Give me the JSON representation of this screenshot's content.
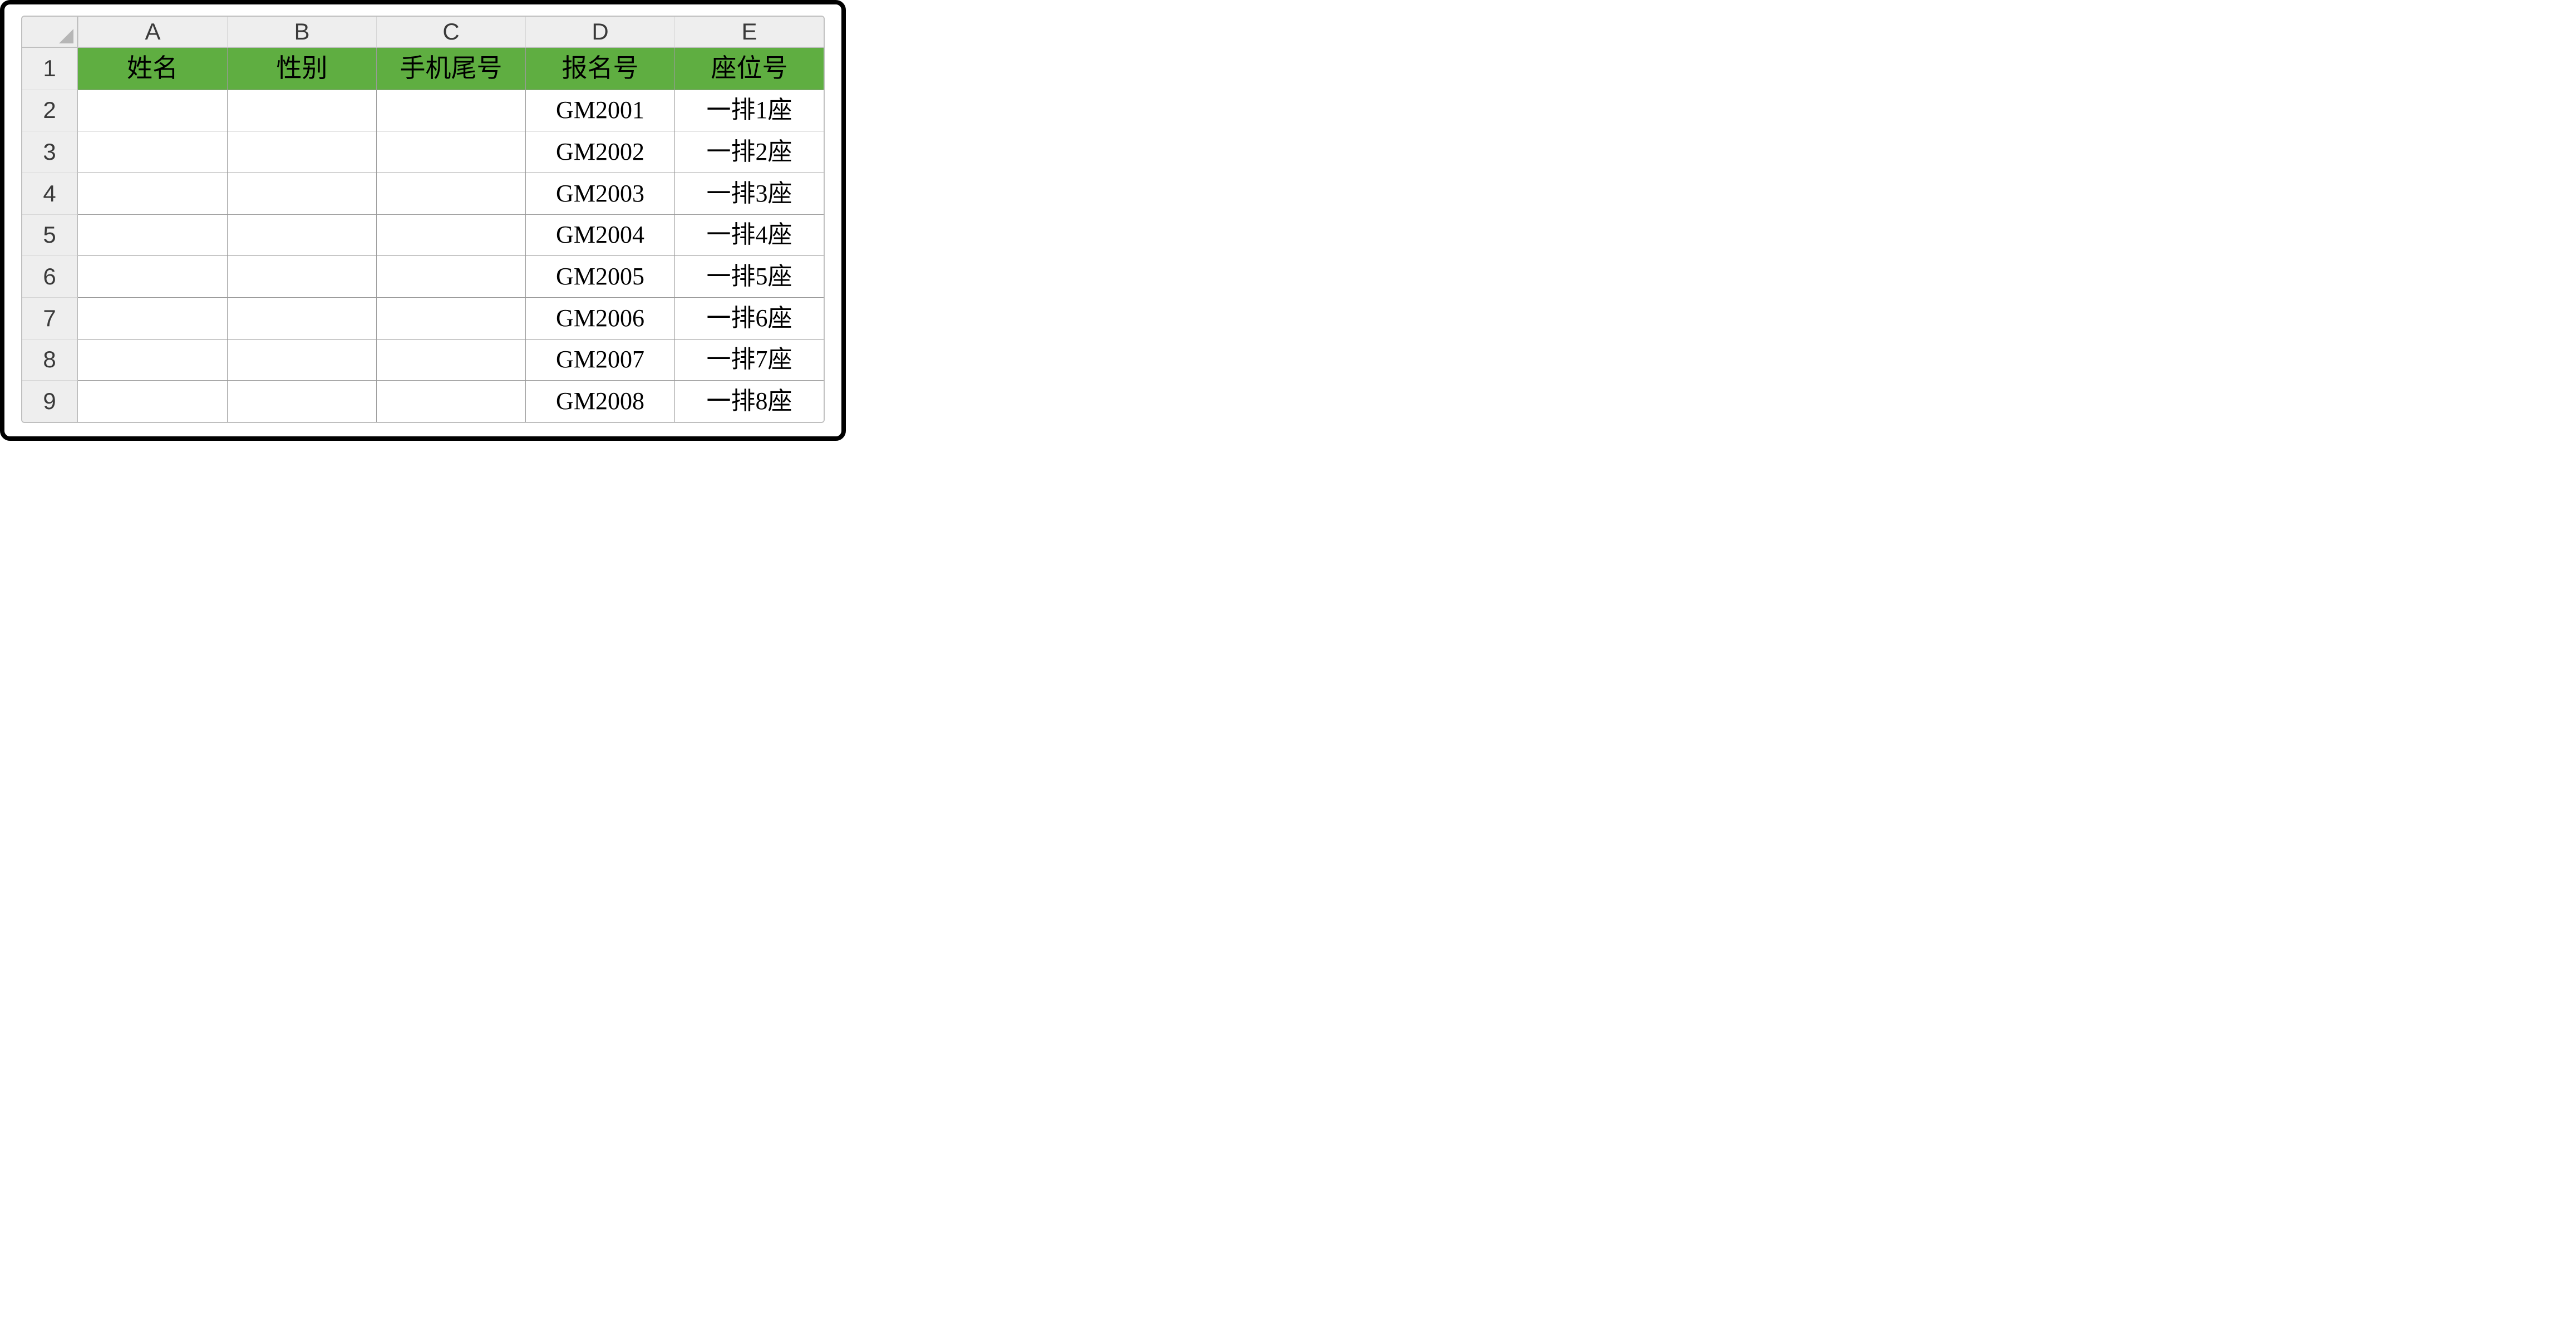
{
  "columns": [
    "A",
    "B",
    "C",
    "D",
    "E"
  ],
  "row_numbers": [
    "1",
    "2",
    "3",
    "4",
    "5",
    "6",
    "7",
    "8",
    "9"
  ],
  "headers": {
    "A": "姓名",
    "B": "性别",
    "C": "手机尾号",
    "D": "报名号",
    "E": "座位号"
  },
  "rows": [
    {
      "A": "",
      "B": "",
      "C": "",
      "D": "GM2001",
      "E": "一排1座"
    },
    {
      "A": "",
      "B": "",
      "C": "",
      "D": "GM2002",
      "E": "一排2座"
    },
    {
      "A": "",
      "B": "",
      "C": "",
      "D": "GM2003",
      "E": "一排3座"
    },
    {
      "A": "",
      "B": "",
      "C": "",
      "D": "GM2004",
      "E": "一排4座"
    },
    {
      "A": "",
      "B": "",
      "C": "",
      "D": "GM2005",
      "E": "一排5座"
    },
    {
      "A": "",
      "B": "",
      "C": "",
      "D": "GM2006",
      "E": "一排6座"
    },
    {
      "A": "",
      "B": "",
      "C": "",
      "D": "GM2007",
      "E": "一排7座"
    },
    {
      "A": "",
      "B": "",
      "C": "",
      "D": "GM2008",
      "E": "一排8座"
    }
  ],
  "chart_data": {
    "type": "table",
    "title": "",
    "columns": [
      "姓名",
      "性别",
      "手机尾号",
      "报名号",
      "座位号"
    ],
    "data": [
      [
        "",
        "",
        "",
        "GM2001",
        "一排1座"
      ],
      [
        "",
        "",
        "",
        "GM2002",
        "一排2座"
      ],
      [
        "",
        "",
        "",
        "GM2003",
        "一排3座"
      ],
      [
        "",
        "",
        "",
        "GM2004",
        "一排4座"
      ],
      [
        "",
        "",
        "",
        "GM2005",
        "一排5座"
      ],
      [
        "",
        "",
        "",
        "GM2006",
        "一排6座"
      ],
      [
        "",
        "",
        "",
        "GM2007",
        "一排7座"
      ],
      [
        "",
        "",
        "",
        "GM2008",
        "一排8座"
      ]
    ]
  }
}
